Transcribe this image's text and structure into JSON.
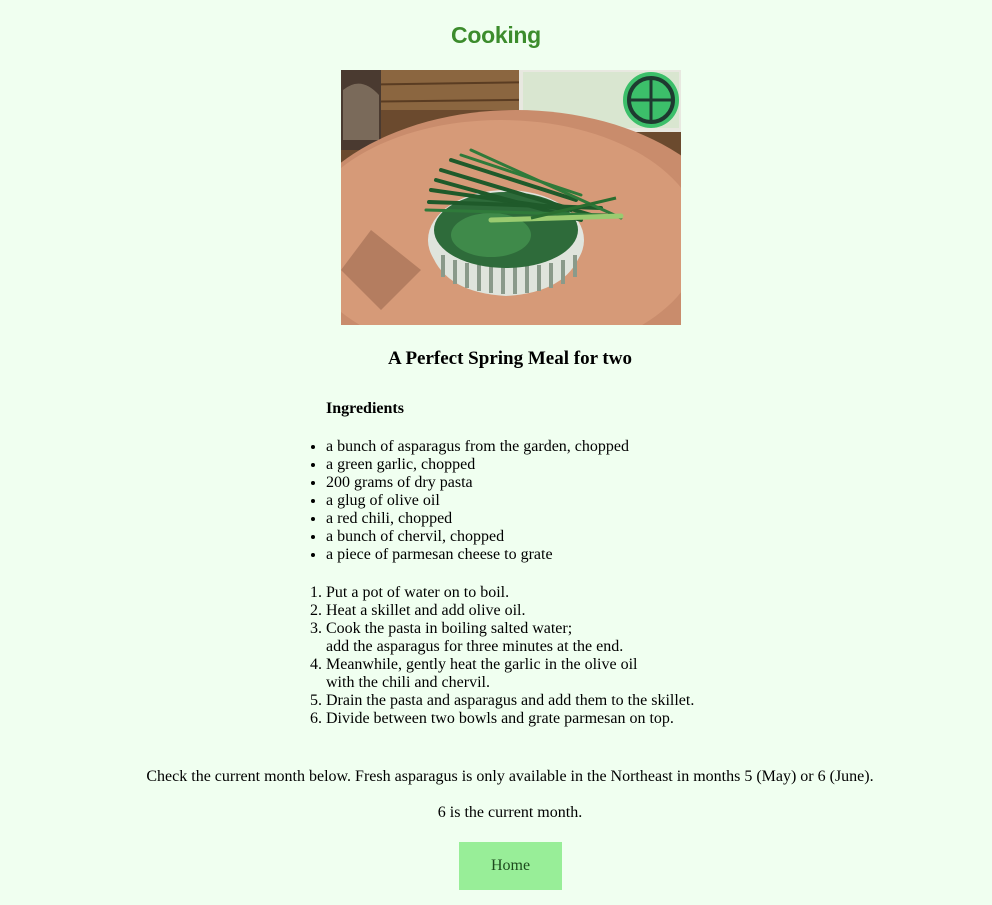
{
  "header": {
    "title": "Cooking"
  },
  "photo": {
    "icon": "asparagus-bowl-photo"
  },
  "recipe": {
    "title": "A Perfect Spring Meal for two",
    "ingredients_heading": "Ingredients",
    "ingredients": [
      "a bunch of asparagus from the garden, chopped",
      "a green garlic, chopped",
      "200 grams of dry pasta",
      "a glug of olive oil",
      "a red chili, chopped",
      "a bunch of chervil, chopped",
      "a piece of parmesan cheese to grate"
    ],
    "steps": [
      {
        "line1": "Put a pot of water on to boil.",
        "line2": ""
      },
      {
        "line1": "Heat a skillet and add olive oil.",
        "line2": ""
      },
      {
        "line1": "Cook the pasta in boiling salted water;",
        "line2": "add the asparagus for three minutes at the end."
      },
      {
        "line1": "Meanwhile, gently heat the garlic in the olive oil",
        "line2": "with the chili and chervil."
      },
      {
        "line1": "Drain the pasta and asparagus and add them to the skillet.",
        "line2": ""
      },
      {
        "line1": "Divide between two bowls and grate parmesan on top.",
        "line2": ""
      }
    ]
  },
  "month_note": "Check the current month below. Fresh asparagus is only available in the Northeast in months 5 (May) or 6 (June).",
  "current_month_text": "6 is the current month.",
  "home_button": {
    "label": "Home"
  },
  "colors": {
    "background": "#f0fff0",
    "title": "#3c8c2c",
    "button": "#98ee98"
  }
}
